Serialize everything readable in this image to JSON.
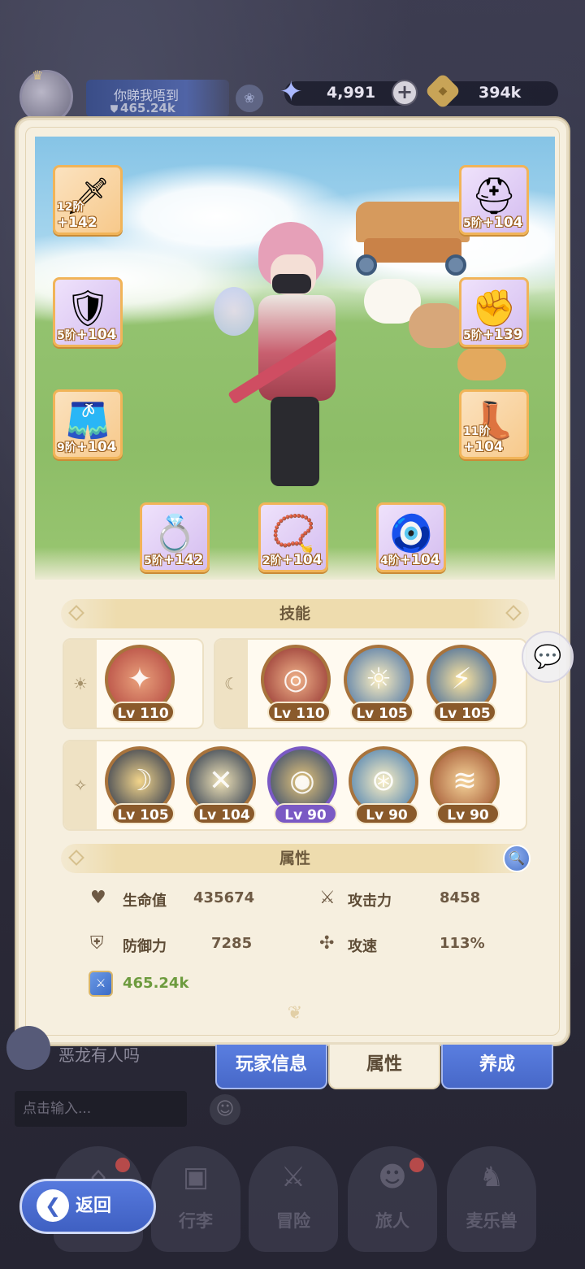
{
  "header": {
    "player_name": "你睇我唔到",
    "player_power": "465.24k",
    "gems": "4,991",
    "plus": "+",
    "coins": "394k",
    "coin_icon": "coin-icon",
    "gem_icon": "gem-icon"
  },
  "equipment": [
    {
      "slot": "weapon",
      "icon": "sword-icon",
      "tier": "12阶",
      "bonus": "+142"
    },
    {
      "slot": "chest",
      "icon": "armor-icon",
      "tier": "5阶",
      "bonus": "+104"
    },
    {
      "slot": "pants",
      "icon": "pants-icon",
      "tier": "9阶",
      "bonus": "+104"
    },
    {
      "slot": "helmet",
      "icon": "helmet-icon",
      "tier": "5阶",
      "bonus": "+104"
    },
    {
      "slot": "gloves",
      "icon": "gauntlet-icon",
      "tier": "5阶",
      "bonus": "+139"
    },
    {
      "slot": "boots",
      "icon": "boots-icon",
      "tier": "11阶",
      "bonus": "+104"
    },
    {
      "slot": "ring",
      "icon": "ring-icon",
      "tier": "5阶",
      "bonus": "+142"
    },
    {
      "slot": "necklace",
      "icon": "necklace-icon",
      "tier": "2阶",
      "bonus": "+104"
    },
    {
      "slot": "charm",
      "icon": "charm-icon",
      "tier": "4阶",
      "bonus": "+104"
    }
  ],
  "skills": {
    "title": "技能",
    "group_sun": [
      {
        "icon": "shuriken-skill-icon",
        "level": "Lv 110"
      }
    ],
    "group_moon": [
      {
        "icon": "vortex-skill-icon",
        "level": "Lv 110"
      },
      {
        "icon": "hero-blast-skill-icon",
        "level": "Lv 105"
      },
      {
        "icon": "hero-charge-skill-icon",
        "level": "Lv 105"
      }
    ],
    "group_star": [
      {
        "icon": "crescent-skill-icon",
        "level": "Lv 105"
      },
      {
        "icon": "slash-skill-icon",
        "level": "Lv 104"
      },
      {
        "icon": "eye-skill-icon",
        "level": "Lv 90",
        "purple": true
      },
      {
        "icon": "target-eye-skill-icon",
        "level": "Lv 90"
      },
      {
        "icon": "claw-skill-icon",
        "level": "Lv 90"
      }
    ]
  },
  "attributes": {
    "title": "属性",
    "hp_label": "生命值",
    "hp_value": "435674",
    "atk_label": "攻击力",
    "atk_value": "8458",
    "def_label": "防御力",
    "def_value": "7285",
    "spd_label": "攻速",
    "spd_value": "113%",
    "power_value": "465.24k"
  },
  "panel_tabs": {
    "player_info": "玩家信息",
    "attributes": "属性",
    "cultivate": "养成"
  },
  "chat": {
    "last_message": "恶龙有人吗",
    "input_placeholder": "点击输入..."
  },
  "nav": {
    "back": "返回",
    "luggage": "行李",
    "adventure": "冒险",
    "traveler": "旅人",
    "beasts": "麦乐兽"
  },
  "colors": {
    "panel_bg": "#f6efdf",
    "tab_blue": "#4768c8",
    "skill_border": "#a8733c",
    "skill_purple": "#7a59c4",
    "power_green": "#6d9b3e"
  }
}
